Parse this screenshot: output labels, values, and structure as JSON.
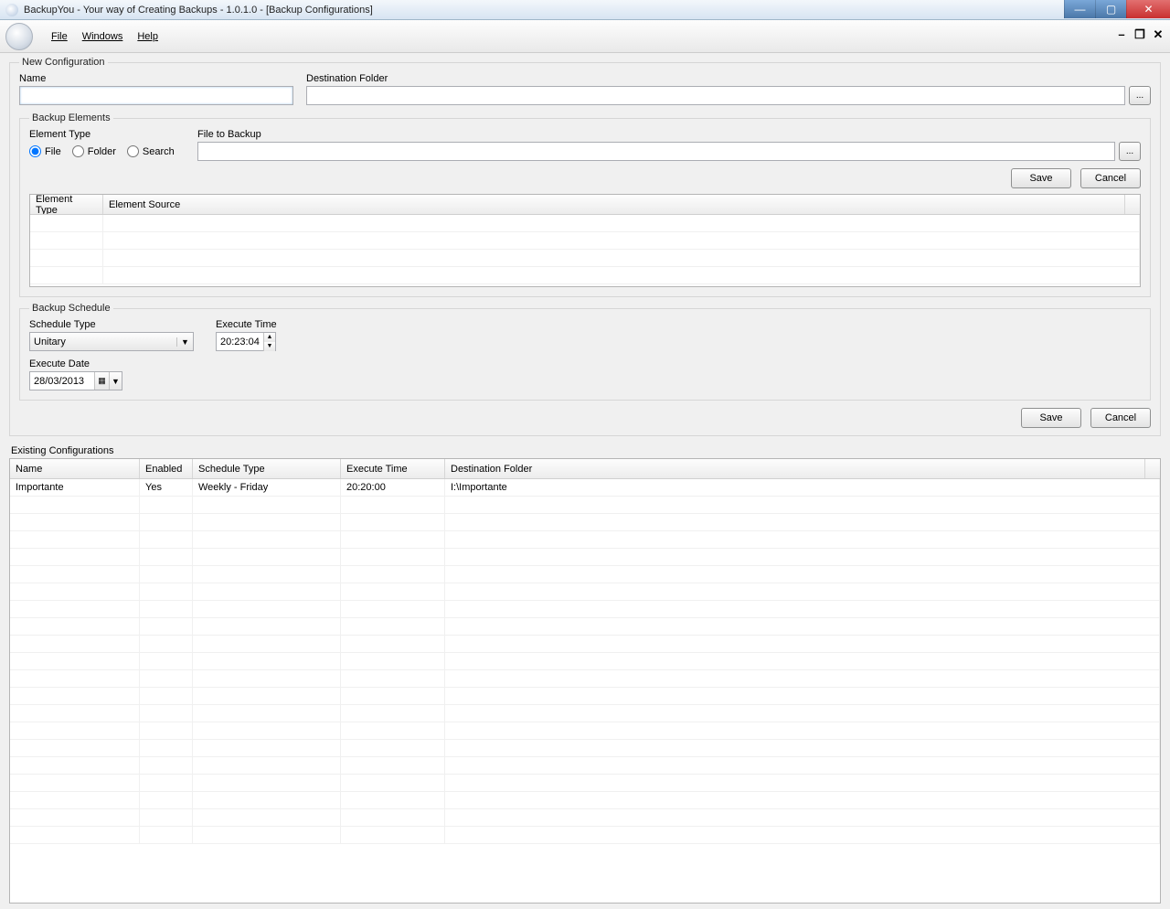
{
  "window": {
    "title": "BackupYou - Your way of Creating Backups - 1.0.1.0 - [Backup Configurations]"
  },
  "menu": {
    "file": "File",
    "windows": "Windows",
    "help": "Help"
  },
  "newConfig": {
    "legend": "New Configuration",
    "nameLabel": "Name",
    "nameValue": "",
    "destLabel": "Destination Folder",
    "destValue": ""
  },
  "backupElements": {
    "legend": "Backup Elements",
    "elementTypeLabel": "Element Type",
    "radios": {
      "file": "File",
      "folder": "Folder",
      "search": "Search"
    },
    "selected": "file",
    "fileToBackupLabel": "File to Backup",
    "fileToBackupValue": "",
    "saveLabel": "Save",
    "cancelLabel": "Cancel",
    "gridHeaders": {
      "type": "Element Type",
      "source": "Element Source"
    }
  },
  "schedule": {
    "legend": "Backup Schedule",
    "typeLabel": "Schedule Type",
    "typeValue": "Unitary",
    "timeLabel": "Execute Time",
    "timeValue": "20:23:04",
    "dateLabel": "Execute Date",
    "dateValue": "28/03/2013",
    "saveLabel": "Save",
    "cancelLabel": "Cancel"
  },
  "existing": {
    "heading": "Existing Configurations",
    "headers": {
      "name": "Name",
      "enabled": "Enabled",
      "schedType": "Schedule Type",
      "execTime": "Execute Time",
      "destFolder": "Destination Folder"
    },
    "rows": [
      {
        "name": "Importante",
        "enabled": "Yes",
        "schedType": "Weekly - Friday",
        "execTime": "20:20:00",
        "destFolder": "I:\\Importante"
      }
    ]
  }
}
